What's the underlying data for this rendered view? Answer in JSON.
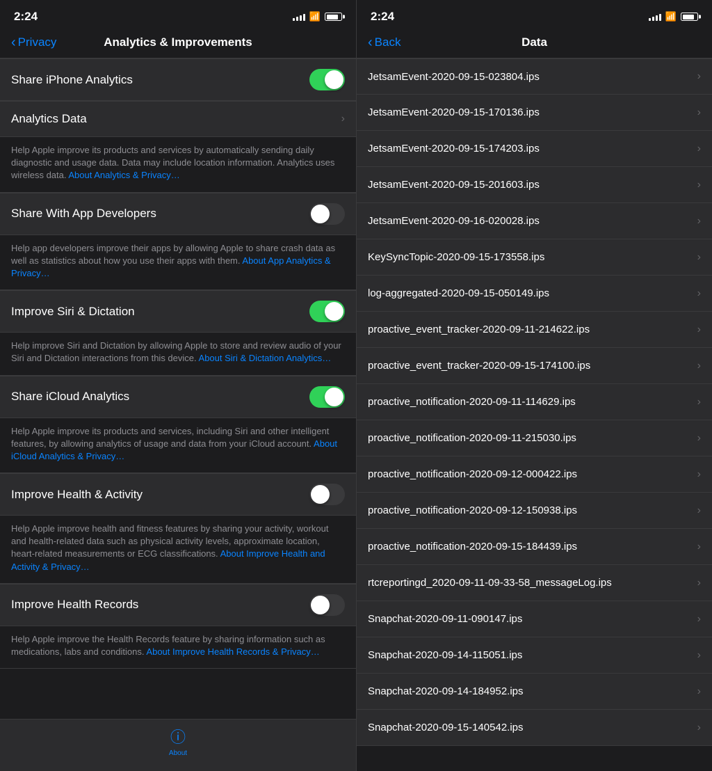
{
  "left": {
    "statusBar": {
      "time": "2:24"
    },
    "navBar": {
      "backLabel": "Privacy",
      "title": "Analytics & Improvements"
    },
    "settings": [
      {
        "id": "share-iphone-analytics",
        "label": "Share iPhone Analytics",
        "type": "toggle",
        "state": "on"
      },
      {
        "id": "analytics-data",
        "label": "Analytics Data",
        "type": "chevron"
      },
      {
        "id": "analytics-description",
        "type": "description",
        "text": "Help Apple improve its products and services by automatically sending daily diagnostic and usage data. Data may include location information. Analytics uses wireless data.",
        "linkText": "About Analytics & Privacy…",
        "link": "#"
      },
      {
        "id": "share-with-app-developers",
        "label": "Share With App Developers",
        "type": "toggle",
        "state": "off"
      },
      {
        "id": "app-developers-description",
        "type": "description",
        "text": "Help app developers improve their apps by allowing Apple to share crash data as well as statistics about how you use their apps with them.",
        "linkText": "About App Analytics & Privacy…",
        "link": "#"
      },
      {
        "id": "improve-siri",
        "label": "Improve Siri & Dictation",
        "type": "toggle",
        "state": "on"
      },
      {
        "id": "siri-description",
        "type": "description",
        "text": "Help improve Siri and Dictation by allowing Apple to store and review audio of your Siri and Dictation interactions from this device.",
        "linkText": "About Siri & Dictation Analytics…",
        "link": "#"
      },
      {
        "id": "share-icloud-analytics",
        "label": "Share iCloud Analytics",
        "type": "toggle",
        "state": "on"
      },
      {
        "id": "icloud-description",
        "type": "description",
        "text": "Help Apple improve its products and services, including Siri and other intelligent features, by allowing analytics of usage and data from your iCloud account.",
        "linkText": "About iCloud Analytics & Privacy…",
        "link": "#"
      },
      {
        "id": "improve-health",
        "label": "Improve Health & Activity",
        "type": "toggle",
        "state": "off"
      },
      {
        "id": "health-description",
        "type": "description",
        "text": "Help Apple improve health and fitness features by sharing your activity, workout and health-related data such as physical activity levels, approximate location, heart-related measurements or ECG classifications.",
        "linkText": "About Improve Health and Activity & Privacy…",
        "link": "#"
      },
      {
        "id": "improve-health-records",
        "label": "Improve Health Records",
        "type": "toggle",
        "state": "off"
      },
      {
        "id": "health-records-description",
        "type": "description",
        "text": "Help Apple improve the Health Records feature by sharing information such as medications, labs and conditions.",
        "linkText": "About Improve Health Records & Privacy…",
        "link": "#"
      }
    ],
    "tabBar": {
      "about": "About"
    }
  },
  "right": {
    "statusBar": {
      "time": "2:24"
    },
    "navBar": {
      "backLabel": "Back",
      "title": "Data"
    },
    "items": [
      "JetsamEvent-2020-09-15-023804.ips",
      "JetsamEvent-2020-09-15-170136.ips",
      "JetsamEvent-2020-09-15-174203.ips",
      "JetsamEvent-2020-09-15-201603.ips",
      "JetsamEvent-2020-09-16-020028.ips",
      "KeySyncTopic-2020-09-15-173558.ips",
      "log-aggregated-2020-09-15-050149.ips",
      "proactive_event_tracker-2020-09-11-214622.ips",
      "proactive_event_tracker-2020-09-15-174100.ips",
      "proactive_notification-2020-09-11-114629.ips",
      "proactive_notification-2020-09-11-215030.ips",
      "proactive_notification-2020-09-12-000422.ips",
      "proactive_notification-2020-09-12-150938.ips",
      "proactive_notification-2020-09-15-184439.ips",
      "rtcreportingd_2020-09-11-09-33-58_messageLog.ips",
      "Snapchat-2020-09-11-090147.ips",
      "Snapchat-2020-09-14-115051.ips",
      "Snapchat-2020-09-14-184952.ips",
      "Snapchat-2020-09-15-140542.ips"
    ]
  }
}
